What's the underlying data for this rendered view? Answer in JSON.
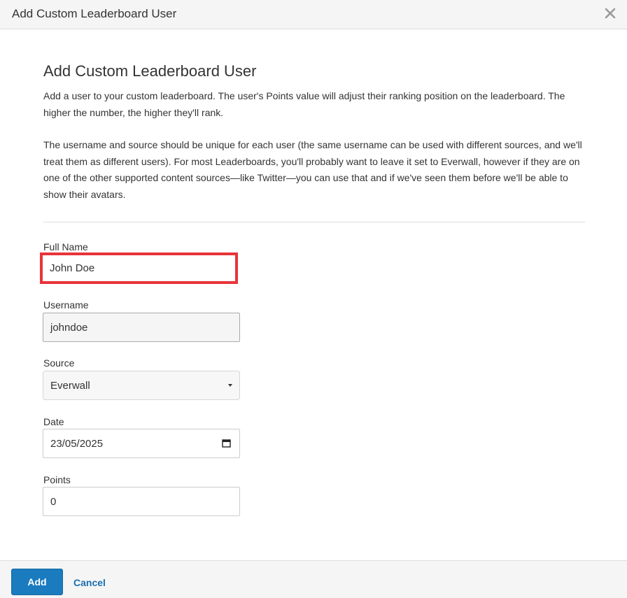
{
  "header": {
    "title": "Add Custom Leaderboard User",
    "close_icon": "close-icon"
  },
  "content": {
    "title": "Add Custom Leaderboard User",
    "paragraph_1": "Add a user to your custom leaderboard. The user's Points value will adjust their ranking position on the leaderboard. The higher the number, the higher they'll rank.",
    "paragraph_2": "The username and source should be unique for each user (the same username can be used with different sources, and we'll treat them as different users). For most Leaderboards, you'll probably want to leave it set to Everwall, however if they are on one of the other supported content sources—like Twitter—you can use that and if we've seen them before we'll be able to show their avatars."
  },
  "form": {
    "full_name": {
      "label": "Full Name",
      "value": "John Doe"
    },
    "username": {
      "label": "Username",
      "value": "johndoe"
    },
    "source": {
      "label": "Source",
      "value": "Everwall",
      "icon": "caret-down-icon"
    },
    "date": {
      "label": "Date",
      "value": "23/05/2025",
      "icon": "calendar-icon"
    },
    "points": {
      "label": "Points",
      "value": "0"
    }
  },
  "footer": {
    "add_label": "Add",
    "cancel_label": "Cancel"
  },
  "colors": {
    "primary": "#1a7bbf",
    "link": "#1a6faf",
    "highlight": "#e8343a",
    "header_bg": "#f5f5f5"
  }
}
